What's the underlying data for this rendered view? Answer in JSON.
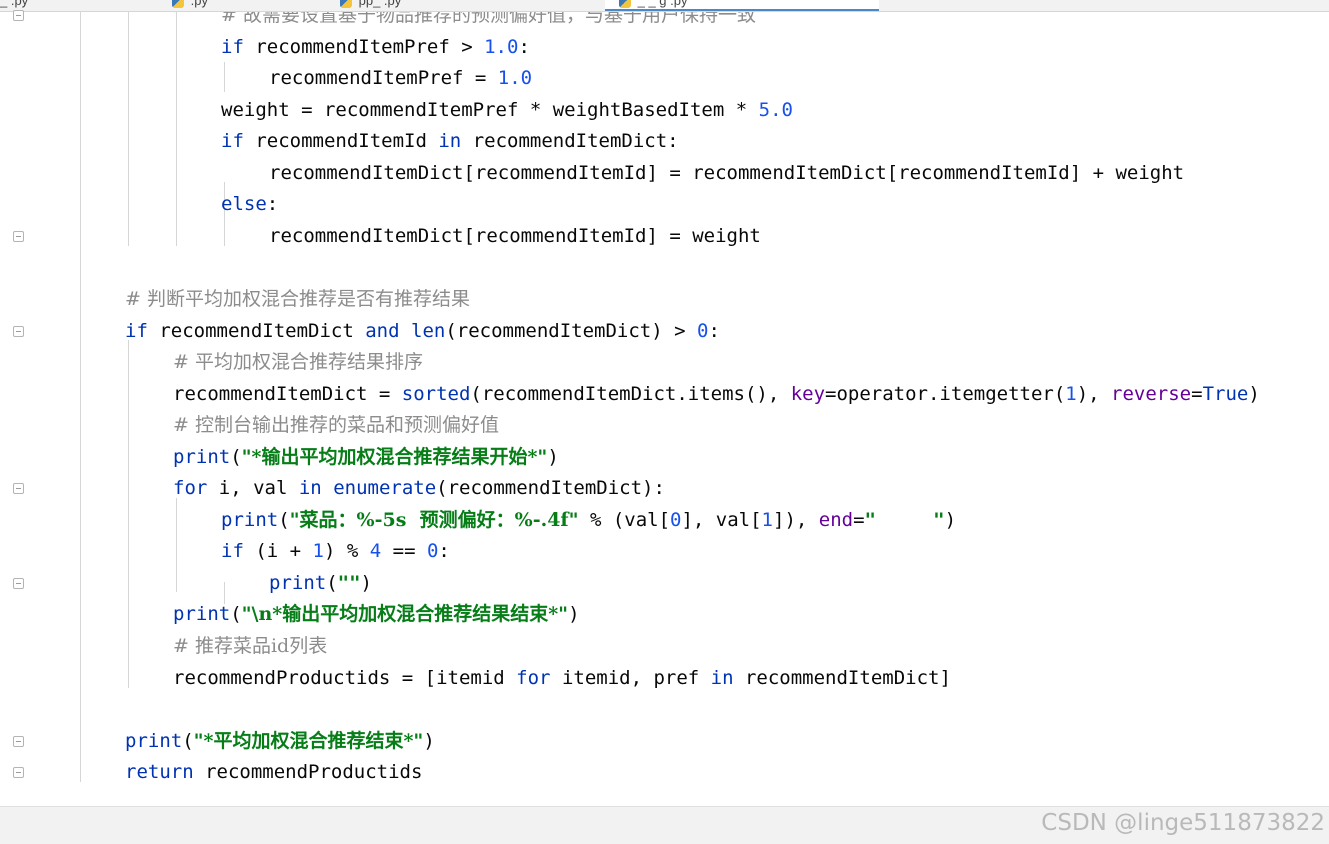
{
  "tabs": [
    {
      "label": "_  .py"
    },
    {
      "label": "  .py"
    },
    {
      "label": "pp_   .py"
    },
    {
      "label": "   _   _ g .py"
    }
  ],
  "code_lines": [
    {
      "indent": 4,
      "tokens": [
        {
          "t": "cmt",
          "v": "# 故需要设置基于物品推荐的预测偏好值，与基于用户保持一致"
        }
      ]
    },
    {
      "indent": 4,
      "tokens": [
        {
          "t": "kw",
          "v": "if"
        },
        {
          "t": "",
          "v": " recommendItemPref > "
        },
        {
          "t": "num",
          "v": "1.0"
        },
        {
          "t": "",
          "v": ":"
        }
      ]
    },
    {
      "indent": 5,
      "tokens": [
        {
          "t": "",
          "v": "recommendItemPref = "
        },
        {
          "t": "num",
          "v": "1.0"
        }
      ]
    },
    {
      "indent": 4,
      "tokens": [
        {
          "t": "",
          "v": "weight = recommendItemPref * weightBasedItem * "
        },
        {
          "t": "num",
          "v": "5.0"
        }
      ]
    },
    {
      "indent": 4,
      "tokens": [
        {
          "t": "kw",
          "v": "if"
        },
        {
          "t": "",
          "v": " recommendItemId "
        },
        {
          "t": "kw",
          "v": "in"
        },
        {
          "t": "",
          "v": " recommendItemDict:"
        }
      ]
    },
    {
      "indent": 5,
      "tokens": [
        {
          "t": "",
          "v": "recommendItemDict[recommendItemId] = recommendItemDict[recommendItemId] + weight"
        }
      ]
    },
    {
      "indent": 4,
      "tokens": [
        {
          "t": "kw",
          "v": "else"
        },
        {
          "t": "",
          "v": ":"
        }
      ]
    },
    {
      "indent": 5,
      "tokens": [
        {
          "t": "",
          "v": "recommendItemDict[recommendItemId] = weight"
        }
      ]
    },
    {
      "indent": 0,
      "tokens": []
    },
    {
      "indent": 2,
      "tokens": [
        {
          "t": "cmt",
          "v": "# 判断平均加权混合推荐是否有推荐结果"
        }
      ]
    },
    {
      "indent": 2,
      "tokens": [
        {
          "t": "kw",
          "v": "if"
        },
        {
          "t": "",
          "v": " recommendItemDict "
        },
        {
          "t": "kw",
          "v": "and"
        },
        {
          "t": "",
          "v": " "
        },
        {
          "t": "builtin",
          "v": "len"
        },
        {
          "t": "",
          "v": "(recommendItemDict) > "
        },
        {
          "t": "num",
          "v": "0"
        },
        {
          "t": "",
          "v": ":"
        }
      ]
    },
    {
      "indent": 3,
      "tokens": [
        {
          "t": "cmt",
          "v": "# 平均加权混合推荐结果排序"
        }
      ]
    },
    {
      "indent": 3,
      "tokens": [
        {
          "t": "",
          "v": "recommendItemDict = "
        },
        {
          "t": "builtin",
          "v": "sorted"
        },
        {
          "t": "",
          "v": "(recommendItemDict.items(), "
        },
        {
          "t": "kwarg",
          "v": "key"
        },
        {
          "t": "",
          "v": "=operator.itemgetter("
        },
        {
          "t": "num",
          "v": "1"
        },
        {
          "t": "",
          "v": "), "
        },
        {
          "t": "kwarg",
          "v": "reverse"
        },
        {
          "t": "",
          "v": "="
        },
        {
          "t": "kw",
          "v": "True"
        },
        {
          "t": "",
          "v": ")"
        }
      ]
    },
    {
      "indent": 3,
      "tokens": [
        {
          "t": "cmt",
          "v": "# 控制台输出推荐的菜品和预测偏好值"
        }
      ]
    },
    {
      "indent": 3,
      "tokens": [
        {
          "t": "builtin",
          "v": "print"
        },
        {
          "t": "",
          "v": "("
        },
        {
          "t": "str",
          "v": "\"*输出平均加权混合推荐结果开始*\""
        },
        {
          "t": "",
          "v": ")"
        }
      ]
    },
    {
      "indent": 3,
      "tokens": [
        {
          "t": "kw",
          "v": "for"
        },
        {
          "t": "",
          "v": " i, val "
        },
        {
          "t": "kw",
          "v": "in"
        },
        {
          "t": "",
          "v": " "
        },
        {
          "t": "builtin",
          "v": "enumerate"
        },
        {
          "t": "",
          "v": "(recommendItemDict):"
        }
      ]
    },
    {
      "indent": 4,
      "tokens": [
        {
          "t": "builtin",
          "v": "print"
        },
        {
          "t": "",
          "v": "("
        },
        {
          "t": "str",
          "v": "\"菜品：%-5s  预测偏好：%-.4f\""
        },
        {
          "t": "",
          "v": " % (val["
        },
        {
          "t": "num",
          "v": "0"
        },
        {
          "t": "",
          "v": "], val["
        },
        {
          "t": "num",
          "v": "1"
        },
        {
          "t": "",
          "v": "]), "
        },
        {
          "t": "kwarg",
          "v": "end"
        },
        {
          "t": "",
          "v": "="
        },
        {
          "t": "str",
          "v": "\"     \""
        },
        {
          "t": "",
          "v": ")"
        }
      ]
    },
    {
      "indent": 4,
      "tokens": [
        {
          "t": "kw",
          "v": "if"
        },
        {
          "t": "",
          "v": " (i + "
        },
        {
          "t": "num",
          "v": "1"
        },
        {
          "t": "",
          "v": ") % "
        },
        {
          "t": "num",
          "v": "4"
        },
        {
          "t": "",
          "v": " == "
        },
        {
          "t": "num",
          "v": "0"
        },
        {
          "t": "",
          "v": ":"
        }
      ]
    },
    {
      "indent": 5,
      "tokens": [
        {
          "t": "builtin",
          "v": "print"
        },
        {
          "t": "",
          "v": "("
        },
        {
          "t": "str",
          "v": "\"\""
        },
        {
          "t": "",
          "v": ")"
        }
      ]
    },
    {
      "indent": 3,
      "tokens": [
        {
          "t": "builtin",
          "v": "print"
        },
        {
          "t": "",
          "v": "("
        },
        {
          "t": "str",
          "v": "\"\\n*输出平均加权混合推荐结果结束*\""
        },
        {
          "t": "",
          "v": ")"
        }
      ]
    },
    {
      "indent": 3,
      "tokens": [
        {
          "t": "cmt",
          "v": "# 推荐菜品id列表"
        }
      ]
    },
    {
      "indent": 3,
      "tokens": [
        {
          "t": "",
          "v": "recommendProductids = [itemid "
        },
        {
          "t": "kw",
          "v": "for"
        },
        {
          "t": "",
          "v": " itemid, pref "
        },
        {
          "t": "kw",
          "v": "in"
        },
        {
          "t": "",
          "v": " recommendItemDict]"
        }
      ]
    },
    {
      "indent": 0,
      "tokens": []
    },
    {
      "indent": 2,
      "tokens": [
        {
          "t": "builtin",
          "v": "print"
        },
        {
          "t": "",
          "v": "("
        },
        {
          "t": "str",
          "v": "\"*平均加权混合推荐结束*\""
        },
        {
          "t": "",
          "v": ")"
        }
      ]
    },
    {
      "indent": 2,
      "tokens": [
        {
          "t": "kw",
          "v": "return"
        },
        {
          "t": "",
          "v": " recommendProductids"
        }
      ]
    }
  ],
  "watermark": "CSDN @linge511873822",
  "icons": {
    "fold_marker": "fold-minus-icon",
    "tab_file": "python-file-icon"
  }
}
